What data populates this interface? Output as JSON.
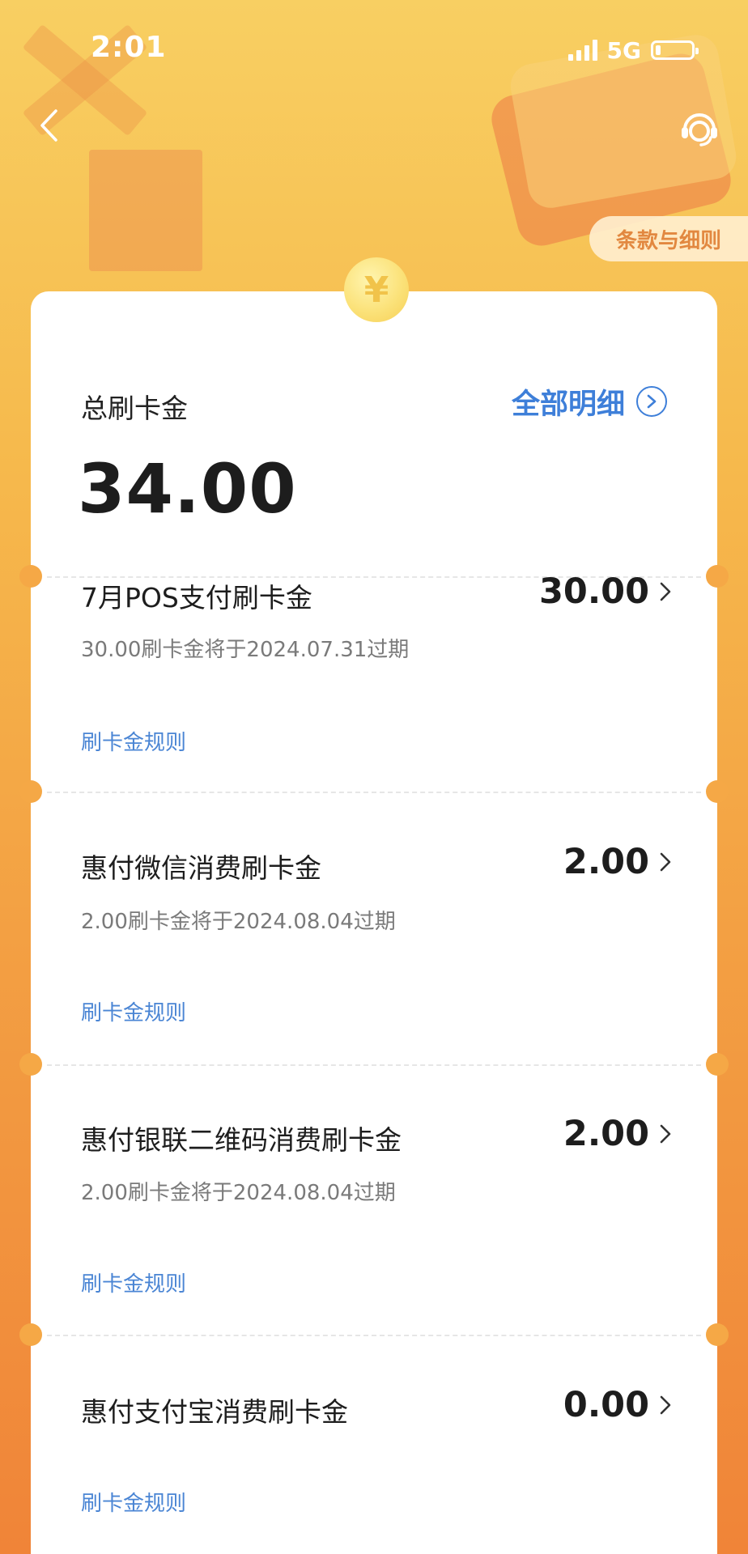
{
  "status_bar": {
    "time": "2:01",
    "network": "5G",
    "battery_level": 0.15
  },
  "header": {
    "back_icon": "chevron-left-icon",
    "service_icon": "customer-service-icon",
    "terms_label": "条款与细则"
  },
  "summary": {
    "title": "总刷卡金",
    "amount": "34.00",
    "details_link": "全部明细",
    "coin_glyph": "¥"
  },
  "items": [
    {
      "name": "7月POS支付刷卡金",
      "amount": "30.00",
      "expiry": "30.00刷卡金将于2024.07.31过期",
      "rule_link": "刷卡金规则"
    },
    {
      "name": "惠付微信消费刷卡金",
      "amount": "2.00",
      "expiry": "2.00刷卡金将于2024.08.04过期",
      "rule_link": "刷卡金规则"
    },
    {
      "name": "惠付银联二维码消费刷卡金",
      "amount": "2.00",
      "expiry": "2.00刷卡金将于2024.08.04过期",
      "rule_link": "刷卡金规则"
    },
    {
      "name": "惠付支付宝消费刷卡金",
      "amount": "0.00",
      "rule_link": "刷卡金规则"
    }
  ],
  "colors": {
    "link_blue": "#3e7fd9",
    "header_orange": "#f6b94c",
    "terms_text": "#e28840"
  }
}
